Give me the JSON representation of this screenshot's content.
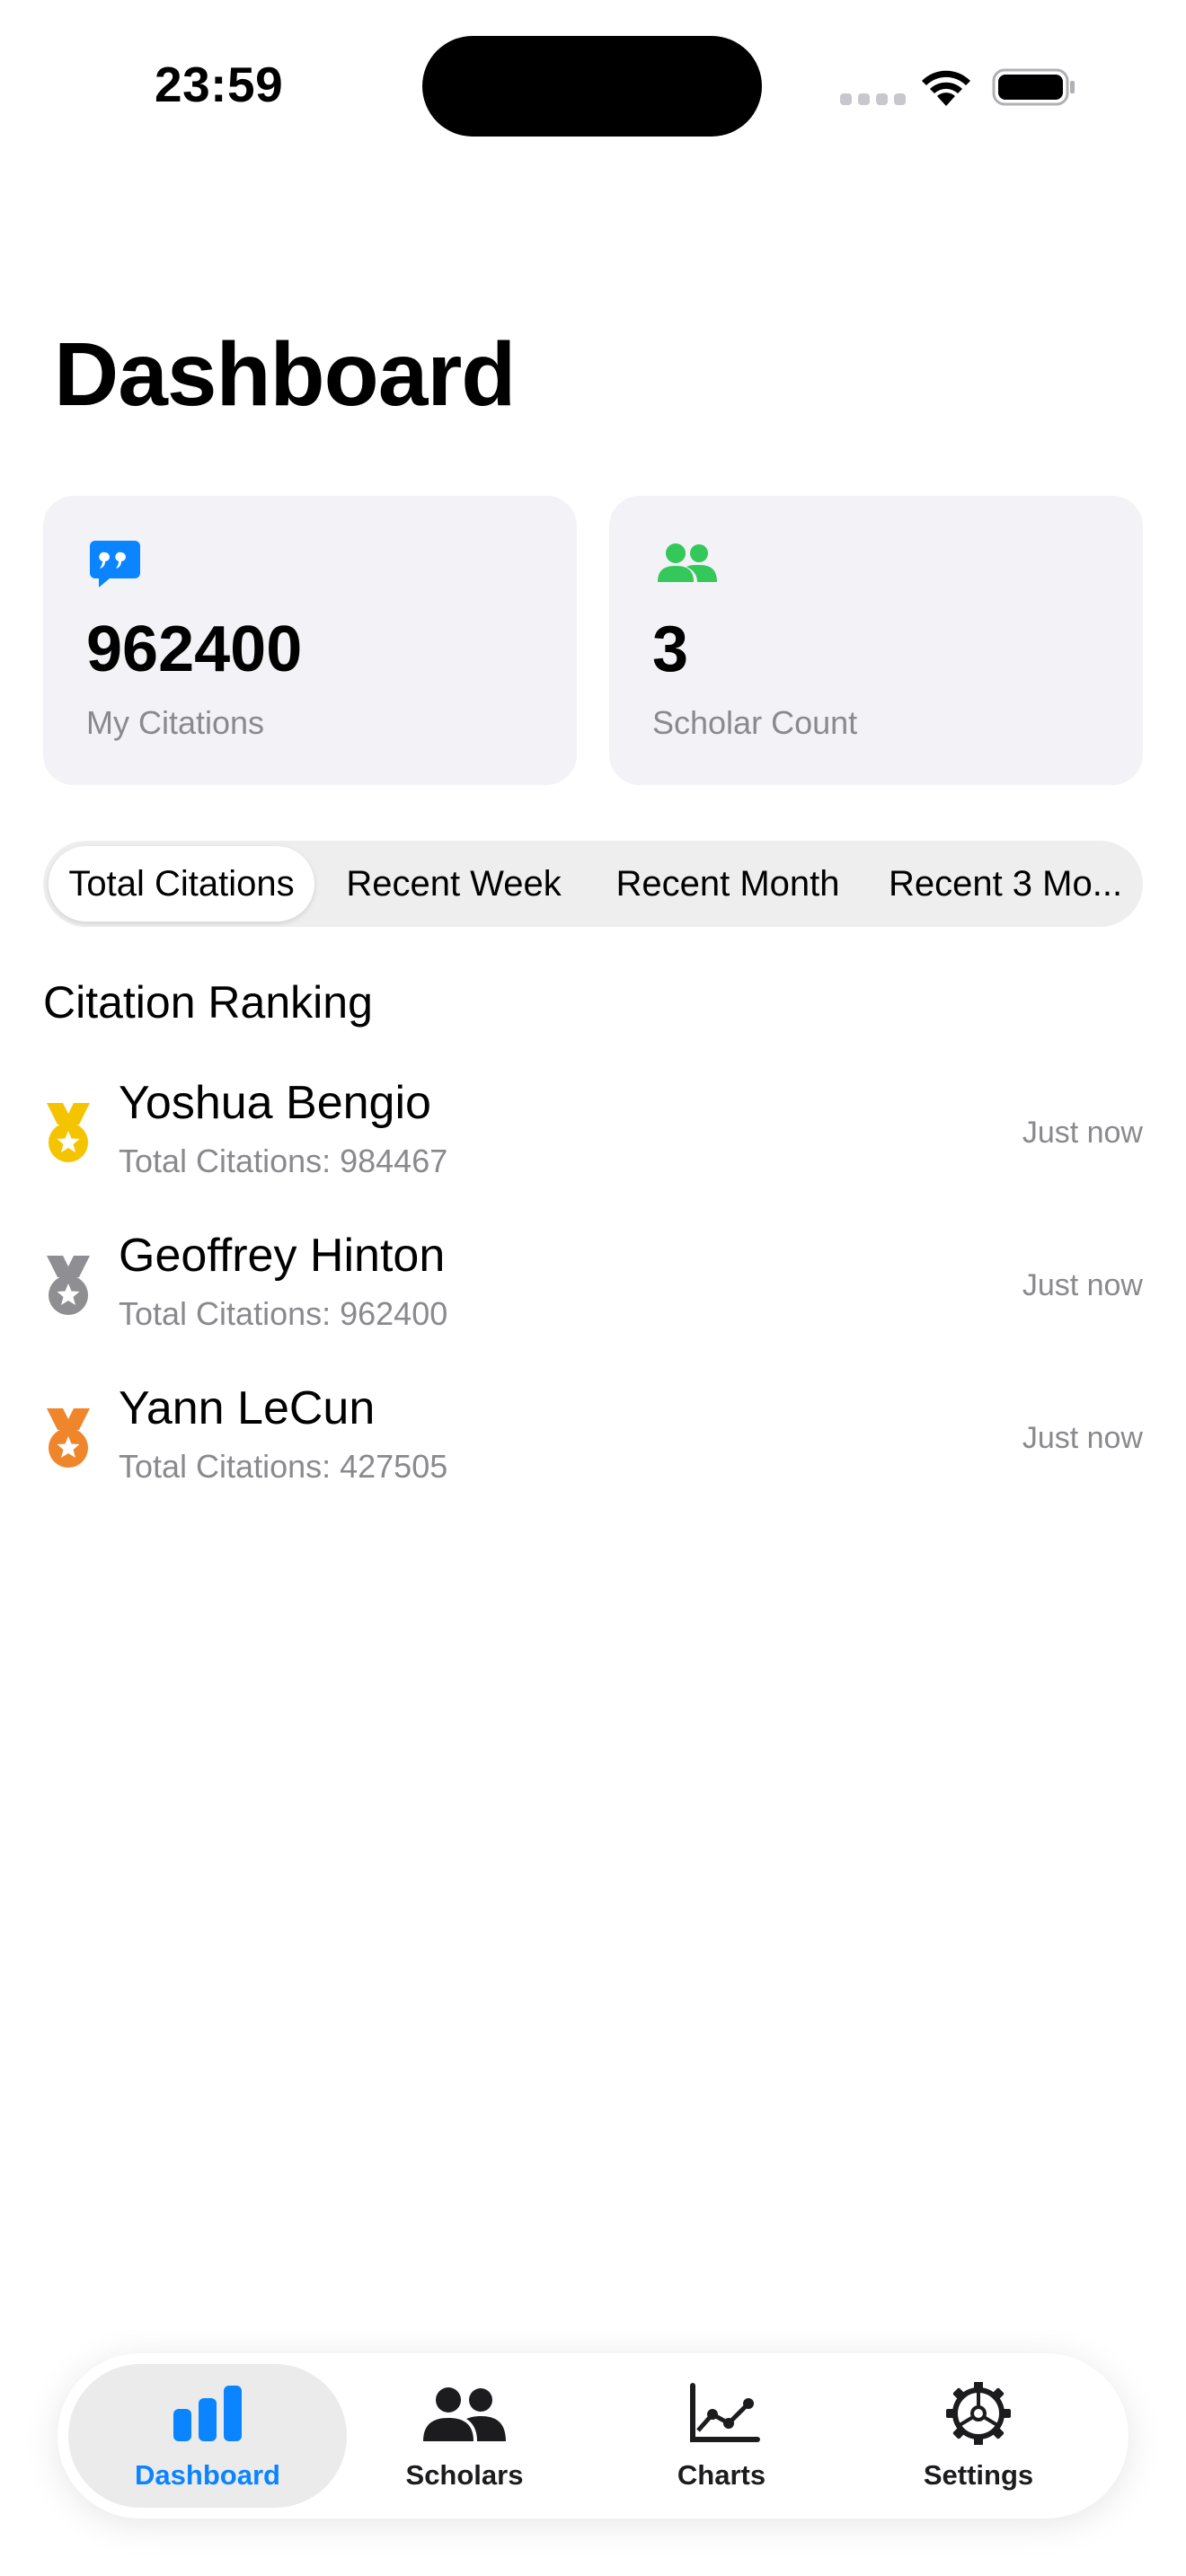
{
  "status_bar": {
    "time": "23:59"
  },
  "page_title": "Dashboard",
  "stats": {
    "citations": {
      "value": "962400",
      "label": "My Citations",
      "icon": "quote-bubble-icon",
      "color": "#0a84ff"
    },
    "scholars": {
      "value": "3",
      "label": "Scholar Count",
      "icon": "people-icon",
      "color": "#34c759"
    }
  },
  "segments": [
    "Total Citations",
    "Recent Week",
    "Recent Month",
    "Recent 3 Mo..."
  ],
  "selected_segment": "Total Citations",
  "ranking": {
    "title": "Citation Ranking",
    "items": [
      {
        "name": "Yoshua Bengio",
        "subtitle": "Total Citations: 984467",
        "time": "Just now",
        "medal": "gold-medal-icon",
        "medal_color": "#f5c400"
      },
      {
        "name": "Geoffrey Hinton",
        "subtitle": "Total Citations: 962400",
        "time": "Just now",
        "medal": "silver-medal-icon",
        "medal_color": "#8e8e93"
      },
      {
        "name": "Yann LeCun",
        "subtitle": "Total Citations: 427505",
        "time": "Just now",
        "medal": "bronze-medal-icon",
        "medal_color": "#f0862b"
      }
    ]
  },
  "tabbar": {
    "items": [
      {
        "label": "Dashboard",
        "icon": "bar-chart-icon"
      },
      {
        "label": "Scholars",
        "icon": "people-icon"
      },
      {
        "label": "Charts",
        "icon": "line-chart-icon"
      },
      {
        "label": "Settings",
        "icon": "gear-icon"
      }
    ],
    "active": "Dashboard",
    "accent": "#0a84ff"
  }
}
